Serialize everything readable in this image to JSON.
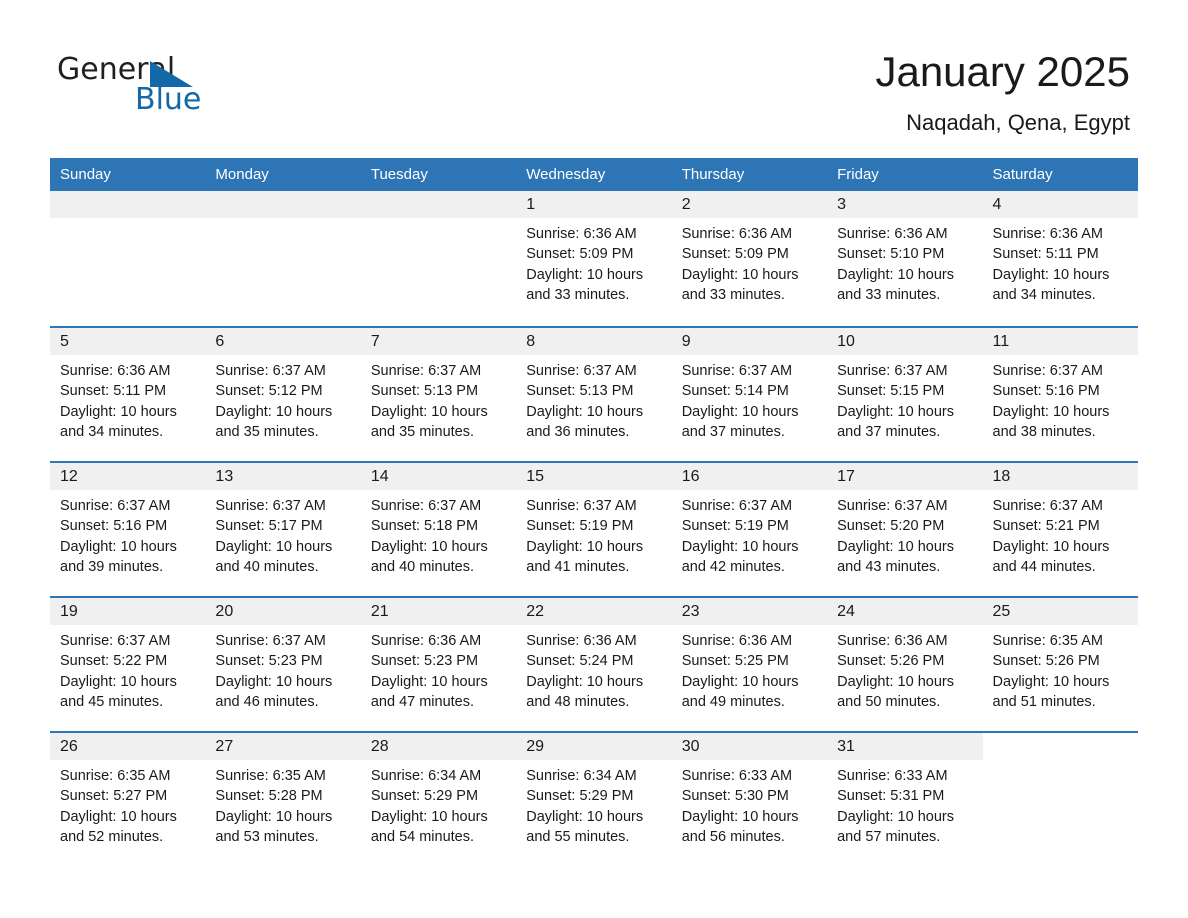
{
  "brand": {
    "name_part1": "General",
    "name_part2": "Blue"
  },
  "header": {
    "month_title": "January 2025",
    "location": "Naqadah, Qena, Egypt"
  },
  "calendar": {
    "weekdays": [
      "Sunday",
      "Monday",
      "Tuesday",
      "Wednesday",
      "Thursday",
      "Friday",
      "Saturday"
    ],
    "colors": {
      "header_blue": "#2e75b6",
      "daynum_band": "#f0f0f0",
      "logo_blue": "#1468a8",
      "text": "#1a1a1a"
    },
    "weeks": [
      [
        {
          "day": "",
          "lines": []
        },
        {
          "day": "",
          "lines": []
        },
        {
          "day": "",
          "lines": []
        },
        {
          "day": "1",
          "lines": [
            "Sunrise: 6:36 AM",
            "Sunset: 5:09 PM",
            "Daylight: 10 hours",
            "and 33 minutes."
          ]
        },
        {
          "day": "2",
          "lines": [
            "Sunrise: 6:36 AM",
            "Sunset: 5:09 PM",
            "Daylight: 10 hours",
            "and 33 minutes."
          ]
        },
        {
          "day": "3",
          "lines": [
            "Sunrise: 6:36 AM",
            "Sunset: 5:10 PM",
            "Daylight: 10 hours",
            "and 33 minutes."
          ]
        },
        {
          "day": "4",
          "lines": [
            "Sunrise: 6:36 AM",
            "Sunset: 5:11 PM",
            "Daylight: 10 hours",
            "and 34 minutes."
          ]
        }
      ],
      [
        {
          "day": "5",
          "lines": [
            "Sunrise: 6:36 AM",
            "Sunset: 5:11 PM",
            "Daylight: 10 hours",
            "and 34 minutes."
          ]
        },
        {
          "day": "6",
          "lines": [
            "Sunrise: 6:37 AM",
            "Sunset: 5:12 PM",
            "Daylight: 10 hours",
            "and 35 minutes."
          ]
        },
        {
          "day": "7",
          "lines": [
            "Sunrise: 6:37 AM",
            "Sunset: 5:13 PM",
            "Daylight: 10 hours",
            "and 35 minutes."
          ]
        },
        {
          "day": "8",
          "lines": [
            "Sunrise: 6:37 AM",
            "Sunset: 5:13 PM",
            "Daylight: 10 hours",
            "and 36 minutes."
          ]
        },
        {
          "day": "9",
          "lines": [
            "Sunrise: 6:37 AM",
            "Sunset: 5:14 PM",
            "Daylight: 10 hours",
            "and 37 minutes."
          ]
        },
        {
          "day": "10",
          "lines": [
            "Sunrise: 6:37 AM",
            "Sunset: 5:15 PM",
            "Daylight: 10 hours",
            "and 37 minutes."
          ]
        },
        {
          "day": "11",
          "lines": [
            "Sunrise: 6:37 AM",
            "Sunset: 5:16 PM",
            "Daylight: 10 hours",
            "and 38 minutes."
          ]
        }
      ],
      [
        {
          "day": "12",
          "lines": [
            "Sunrise: 6:37 AM",
            "Sunset: 5:16 PM",
            "Daylight: 10 hours",
            "and 39 minutes."
          ]
        },
        {
          "day": "13",
          "lines": [
            "Sunrise: 6:37 AM",
            "Sunset: 5:17 PM",
            "Daylight: 10 hours",
            "and 40 minutes."
          ]
        },
        {
          "day": "14",
          "lines": [
            "Sunrise: 6:37 AM",
            "Sunset: 5:18 PM",
            "Daylight: 10 hours",
            "and 40 minutes."
          ]
        },
        {
          "day": "15",
          "lines": [
            "Sunrise: 6:37 AM",
            "Sunset: 5:19 PM",
            "Daylight: 10 hours",
            "and 41 minutes."
          ]
        },
        {
          "day": "16",
          "lines": [
            "Sunrise: 6:37 AM",
            "Sunset: 5:19 PM",
            "Daylight: 10 hours",
            "and 42 minutes."
          ]
        },
        {
          "day": "17",
          "lines": [
            "Sunrise: 6:37 AM",
            "Sunset: 5:20 PM",
            "Daylight: 10 hours",
            "and 43 minutes."
          ]
        },
        {
          "day": "18",
          "lines": [
            "Sunrise: 6:37 AM",
            "Sunset: 5:21 PM",
            "Daylight: 10 hours",
            "and 44 minutes."
          ]
        }
      ],
      [
        {
          "day": "19",
          "lines": [
            "Sunrise: 6:37 AM",
            "Sunset: 5:22 PM",
            "Daylight: 10 hours",
            "and 45 minutes."
          ]
        },
        {
          "day": "20",
          "lines": [
            "Sunrise: 6:37 AM",
            "Sunset: 5:23 PM",
            "Daylight: 10 hours",
            "and 46 minutes."
          ]
        },
        {
          "day": "21",
          "lines": [
            "Sunrise: 6:36 AM",
            "Sunset: 5:23 PM",
            "Daylight: 10 hours",
            "and 47 minutes."
          ]
        },
        {
          "day": "22",
          "lines": [
            "Sunrise: 6:36 AM",
            "Sunset: 5:24 PM",
            "Daylight: 10 hours",
            "and 48 minutes."
          ]
        },
        {
          "day": "23",
          "lines": [
            "Sunrise: 6:36 AM",
            "Sunset: 5:25 PM",
            "Daylight: 10 hours",
            "and 49 minutes."
          ]
        },
        {
          "day": "24",
          "lines": [
            "Sunrise: 6:36 AM",
            "Sunset: 5:26 PM",
            "Daylight: 10 hours",
            "and 50 minutes."
          ]
        },
        {
          "day": "25",
          "lines": [
            "Sunrise: 6:35 AM",
            "Sunset: 5:26 PM",
            "Daylight: 10 hours",
            "and 51 minutes."
          ]
        }
      ],
      [
        {
          "day": "26",
          "lines": [
            "Sunrise: 6:35 AM",
            "Sunset: 5:27 PM",
            "Daylight: 10 hours",
            "and 52 minutes."
          ]
        },
        {
          "day": "27",
          "lines": [
            "Sunrise: 6:35 AM",
            "Sunset: 5:28 PM",
            "Daylight: 10 hours",
            "and 53 minutes."
          ]
        },
        {
          "day": "28",
          "lines": [
            "Sunrise: 6:34 AM",
            "Sunset: 5:29 PM",
            "Daylight: 10 hours",
            "and 54 minutes."
          ]
        },
        {
          "day": "29",
          "lines": [
            "Sunrise: 6:34 AM",
            "Sunset: 5:29 PM",
            "Daylight: 10 hours",
            "and 55 minutes."
          ]
        },
        {
          "day": "30",
          "lines": [
            "Sunrise: 6:33 AM",
            "Sunset: 5:30 PM",
            "Daylight: 10 hours",
            "and 56 minutes."
          ]
        },
        {
          "day": "31",
          "lines": [
            "Sunrise: 6:33 AM",
            "Sunset: 5:31 PM",
            "Daylight: 10 hours",
            "and 57 minutes."
          ]
        },
        {
          "day": "",
          "lines": []
        }
      ]
    ]
  }
}
